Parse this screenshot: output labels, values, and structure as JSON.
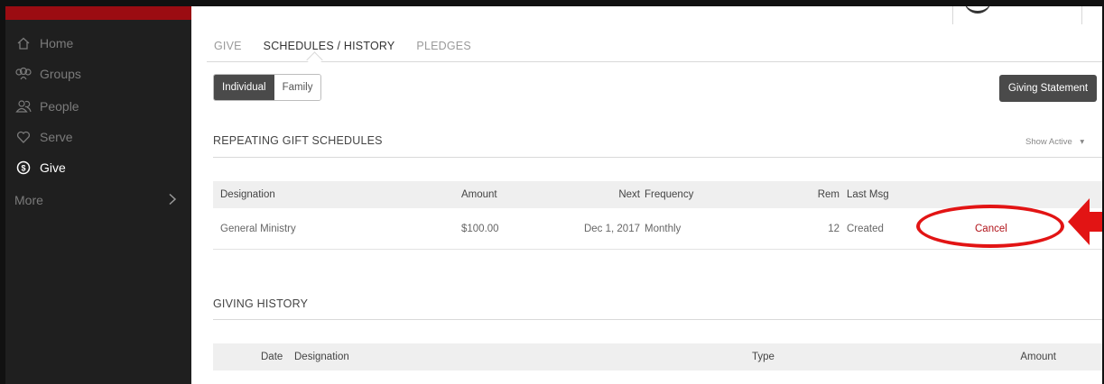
{
  "sidebar": {
    "items": [
      {
        "label": "Home",
        "icon": "home-icon",
        "active": false
      },
      {
        "label": "Groups",
        "icon": "groups-icon",
        "active": false
      },
      {
        "label": "People",
        "icon": "people-icon",
        "active": false
      },
      {
        "label": "Serve",
        "icon": "heart-icon",
        "active": false
      },
      {
        "label": "Give",
        "icon": "dollar-circle-icon",
        "active": true
      }
    ],
    "more_label": "More",
    "more_icon": "chevron-right-icon"
  },
  "tabs": [
    {
      "label": "GIVE",
      "active": false
    },
    {
      "label": "SCHEDULES / HISTORY",
      "active": true
    },
    {
      "label": "PLEDGES",
      "active": false
    }
  ],
  "toggle": {
    "individual_label": "Individual",
    "family_label": "Family",
    "selected": "Individual"
  },
  "giving_statement_label": "Giving Statement",
  "repeating": {
    "title": "REPEATING GIFT SCHEDULES",
    "filter_label": "Show Active",
    "filter_icon": "caret-down-icon",
    "columns": {
      "designation": "Designation",
      "amount": "Amount",
      "next": "Next",
      "frequency": "Frequency",
      "rem": "Rem",
      "last_msg": "Last Msg"
    },
    "rows": [
      {
        "designation": "General Ministry",
        "amount": "$100.00",
        "next": "Dec 1, 2017",
        "frequency": "Monthly",
        "rem": "12",
        "last_msg": "Created",
        "action": "Cancel"
      }
    ]
  },
  "history": {
    "title": "GIVING HISTORY",
    "columns": {
      "date": "Date",
      "designation": "Designation",
      "type": "Type",
      "amount": "Amount"
    }
  },
  "colors": {
    "sidebar_bg": "#1f1f1f",
    "brand_red": "#9b0c12",
    "cancel_red": "#b1141b",
    "annotation_red": "#e21414",
    "button_dark": "#4a4a4a"
  }
}
